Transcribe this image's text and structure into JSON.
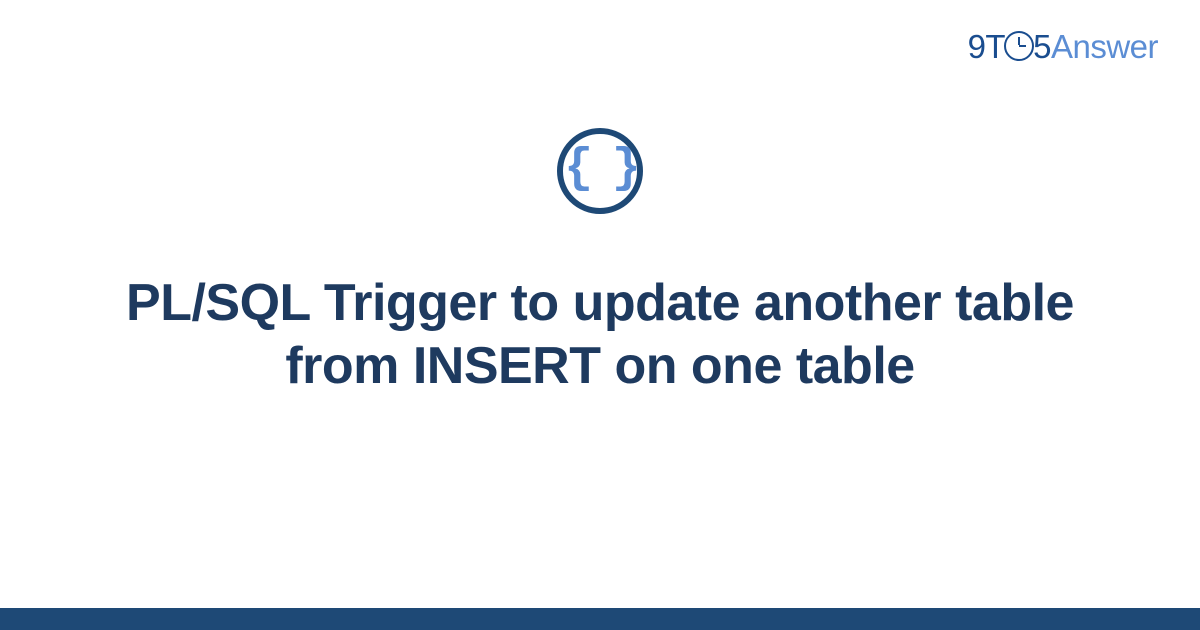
{
  "logo": {
    "part1": "9T",
    "part2": "5",
    "part3": "Answer"
  },
  "icon": {
    "name": "code-braces-icon",
    "glyph": "{ }"
  },
  "title": "PL/SQL Trigger to update another table from INSERT on one table",
  "colors": {
    "darkBlue": "#1e4976",
    "lightBlue": "#5b8dd4",
    "titleColor": "#1e3a5f"
  }
}
